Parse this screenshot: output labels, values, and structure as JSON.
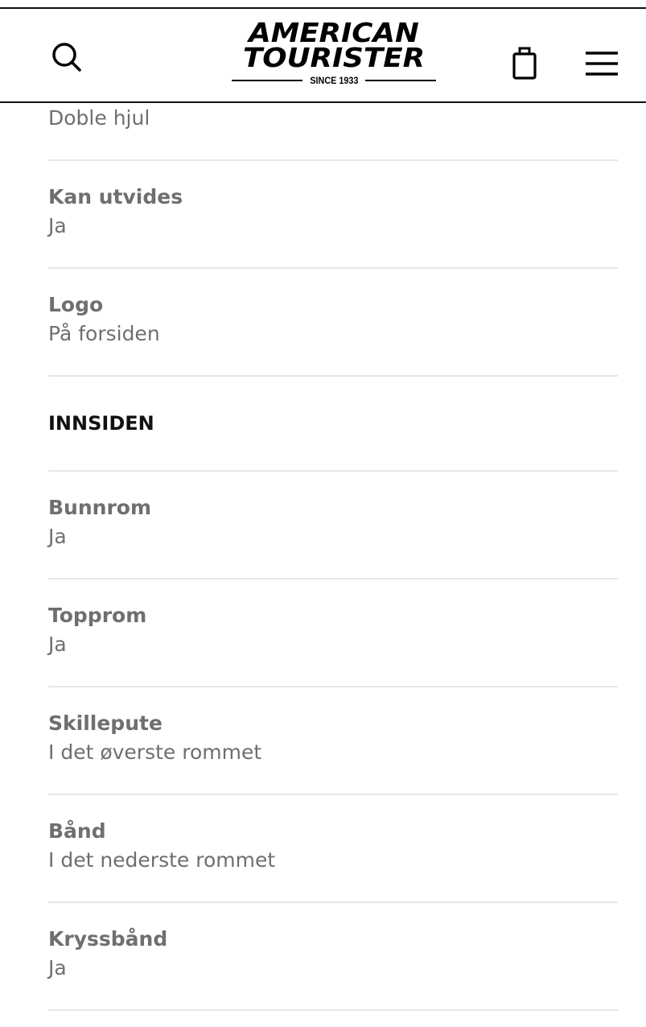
{
  "header": {
    "logo_line1": "AMERICAN",
    "logo_line2": "TOURISTER",
    "logo_since": "SINCE 1933",
    "icons": {
      "search": "search-icon",
      "bag": "shopping-bag-icon",
      "menu": "hamburger-menu-icon"
    }
  },
  "specs_top": {
    "partial_value": "Doble hjul",
    "items": [
      {
        "label": "Kan utvides",
        "value": "Ja"
      },
      {
        "label": "Logo",
        "value": "På forsiden"
      }
    ]
  },
  "section_inside": {
    "title": "INNSIDEN",
    "items": [
      {
        "label": "Bunnrom",
        "value": "Ja"
      },
      {
        "label": "Topprom",
        "value": "Ja"
      },
      {
        "label": "Skillepute",
        "value": "I det øverste rommet"
      },
      {
        "label": "Bånd",
        "value": "I det nederste rommet"
      },
      {
        "label": "Kryssbånd",
        "value": "Ja"
      }
    ]
  },
  "colors": {
    "text_muted": "#6f6f6f",
    "text_strong": "#111111",
    "divider": "#e6e6e6",
    "header_border": "#111111",
    "background": "#ffffff"
  }
}
